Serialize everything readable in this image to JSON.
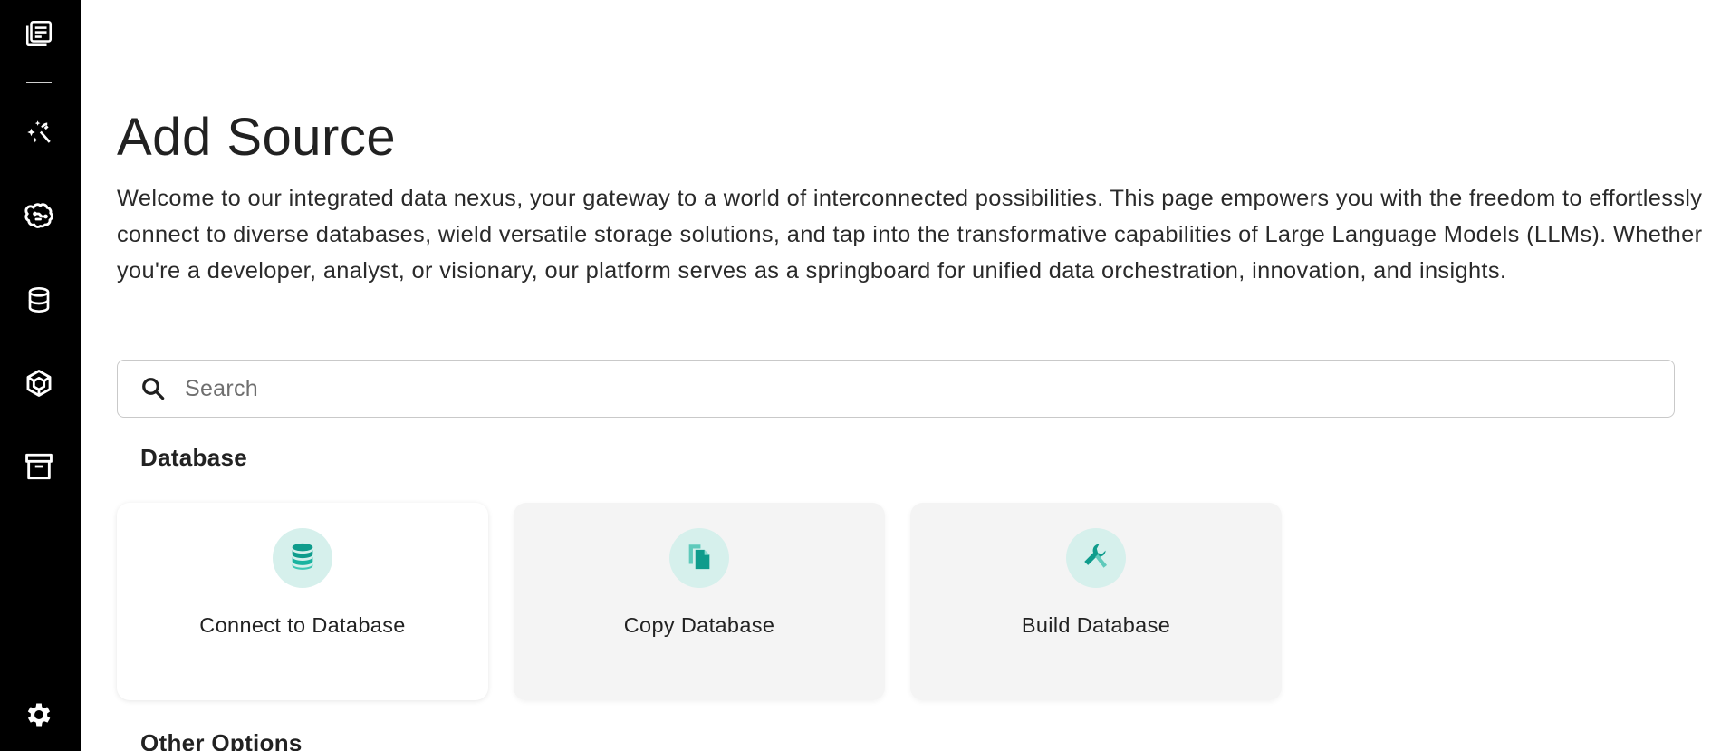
{
  "sidebar": {
    "items": [
      {
        "name": "library",
        "icon": "library-books-icon"
      },
      {
        "name": "prompt",
        "icon": "magic-prompt-icon"
      },
      {
        "name": "models",
        "icon": "brain-icon"
      },
      {
        "name": "databases",
        "icon": "database-icon"
      },
      {
        "name": "apps",
        "icon": "cube-icon"
      },
      {
        "name": "storage",
        "icon": "archive-icon"
      },
      {
        "name": "settings",
        "icon": "gear-icon"
      }
    ]
  },
  "page": {
    "title": "Add Source",
    "description": "Welcome to our integrated data nexus, your gateway to a world of interconnected possibilities. This page empowers you with the freedom to effortlessly connect to diverse databases, wield versatile storage solutions, and tap into the transformative capabilities of Large Language Models (LLMs). Whether you're a developer, analyst, or visionary, our platform serves as a springboard for unified data orchestration, innovation, and insights."
  },
  "search": {
    "placeholder": "Search",
    "value": ""
  },
  "sections": [
    {
      "title": "Database",
      "cards": [
        {
          "label": "Connect to Database",
          "icon": "database-icon"
        },
        {
          "label": "Copy Database",
          "icon": "copy-file-icon"
        },
        {
          "label": "Build Database",
          "icon": "wrench-icon"
        }
      ]
    },
    {
      "title": "Other Options"
    }
  ],
  "colors": {
    "sidebar_bg": "#000000",
    "accent": "#1aa595",
    "icon_circle": "#d6f0ec",
    "card_bg": "#f4f4f4"
  }
}
